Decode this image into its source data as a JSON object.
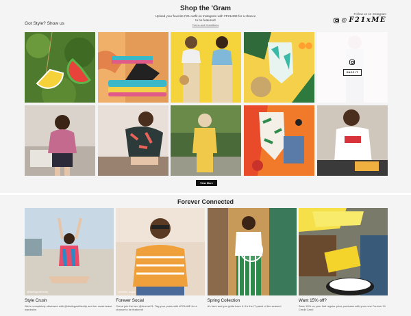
{
  "gram": {
    "title": "Shop the 'Gram",
    "subtitle": "Upload your favorite F21 outfit on Instagram with #F21xME for a chance to be featured!",
    "terms": "Terms and Conditions",
    "got_style": "Got Style? Show us",
    "follow_label": "Follow us on Instagram",
    "at_sign": "@",
    "handle": "F21xME",
    "shop_it": "SHOP IT",
    "view_more": "View More"
  },
  "connected": {
    "title": "Forever Connected",
    "cards": [
      {
        "title": "Style Crush",
        "text": "We're completely obsessed with @darlingestthecity and her mask-tease wardrobe.",
        "tag": "@darlingestthecity"
      },
      {
        "title": "Forever Social",
        "text": "Come join the fam @forever21. Tag your posts with #F21xME for a chance to be featured!",
        "tag": "@velvet_sugar"
      },
      {
        "title": "Spring Collection",
        "text": "It's here and you gotta have it. It's the IT panel of the season!",
        "tag": ""
      },
      {
        "title": "Want 15% off?",
        "text": "Save 15% on your first regular price purchase with your new Forever 21 Credit Card!",
        "tag": ""
      }
    ]
  }
}
